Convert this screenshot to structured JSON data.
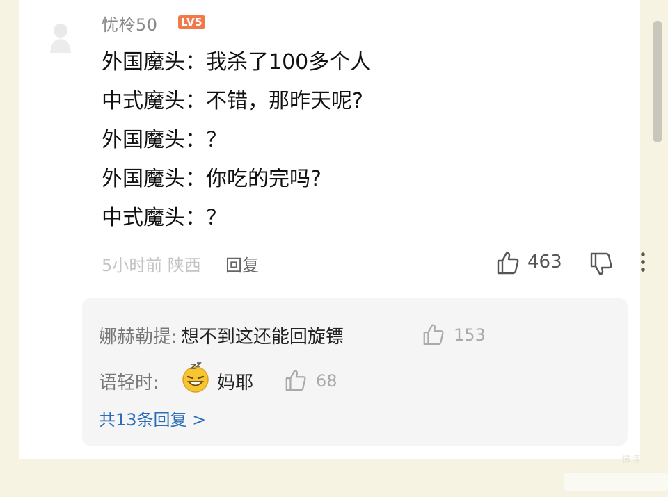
{
  "comment": {
    "username": "忧柃50",
    "level_badge": "LV5",
    "lines": [
      "外国魔头：我杀了100多个人",
      "中式魔头：不错，那昨天呢?",
      "外国魔头：？",
      "外国魔头：你吃的完吗?",
      "中式魔头：？"
    ],
    "time_location": "5小时前 陕西",
    "reply_label": "回复",
    "like_count": "463"
  },
  "replies": {
    "items": [
      {
        "name": "娜赫勒提:",
        "text": "想不到这还能回旋镖",
        "likes": "153"
      },
      {
        "name": "语轻时:",
        "text": "妈耶",
        "likes": "68",
        "emoji": "grinning-sweat-face"
      }
    ],
    "view_all": "共13条回复 >"
  },
  "colors": {
    "page_background": "#f7f3e3",
    "card_background": "#ffffff",
    "level_badge": "#f07a4a",
    "link_blue": "#2b6db8",
    "replies_background": "#f5f5f5"
  },
  "icons": {
    "like": "thumbs-up-icon",
    "dislike": "thumbs-down-icon",
    "more": "more-vertical-icon",
    "avatar": "avatar-icon"
  },
  "watermark": "微博"
}
